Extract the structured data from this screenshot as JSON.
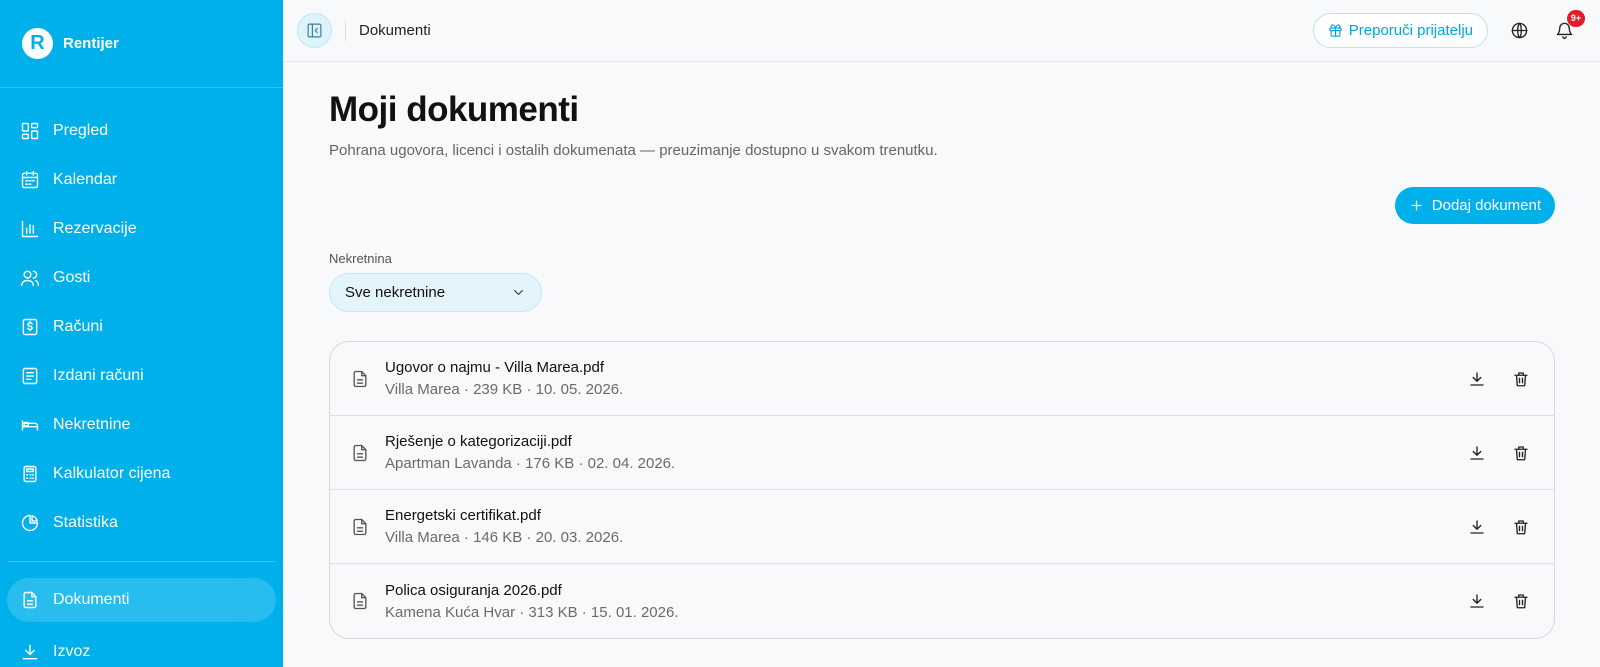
{
  "brand": {
    "logo_letter": "R",
    "name": "Rentijer",
    "color": "#00b0eb"
  },
  "sidebar": {
    "items": [
      {
        "label": "Pregled",
        "icon": "dashboard-icon"
      },
      {
        "label": "Kalendar",
        "icon": "calendar-icon"
      },
      {
        "label": "Rezervacije",
        "icon": "bar-chart-icon"
      },
      {
        "label": "Gosti",
        "icon": "users-icon"
      },
      {
        "label": "Računi",
        "icon": "invoice-dollar-icon"
      },
      {
        "label": "Izdani računi",
        "icon": "receipt-icon"
      },
      {
        "label": "Nekretnine",
        "icon": "bed-icon"
      },
      {
        "label": "Kalkulator cijena",
        "icon": "calculator-icon"
      },
      {
        "label": "Statistika",
        "icon": "pie-chart-icon"
      },
      {
        "label": "Dokumenti",
        "icon": "document-icon",
        "active": true
      },
      {
        "label": "Izvoz",
        "icon": "download-icon"
      }
    ]
  },
  "topbar": {
    "title": "Dokumenti",
    "refer_label": "Preporuči prijatelju",
    "notifications_badge": "9+"
  },
  "main": {
    "title": "Moji dokumenti",
    "subtitle": "Pohrana ugovora, licenci i ostalih dokumenata — preuzimanje dostupno u svakom trenutku.",
    "add_label": "Dodaj dokument",
    "filter_label": "Nekretnina",
    "filter_value": "Sve nekretnine",
    "documents": [
      {
        "name": "Ugovor o najmu - Villa Marea.pdf",
        "meta": "Villa Marea · 239 KB · 10. 05. 2026."
      },
      {
        "name": "Rješenje o kategorizaciji.pdf",
        "meta": "Apartman Lavanda · 176 KB · 02. 04. 2026."
      },
      {
        "name": "Energetski certifikat.pdf",
        "meta": "Villa Marea · 146 KB · 20. 03. 2026."
      },
      {
        "name": "Polica osiguranja 2026.pdf",
        "meta": "Kamena Kuća Hvar · 313 KB · 15. 01. 2026."
      }
    ]
  }
}
